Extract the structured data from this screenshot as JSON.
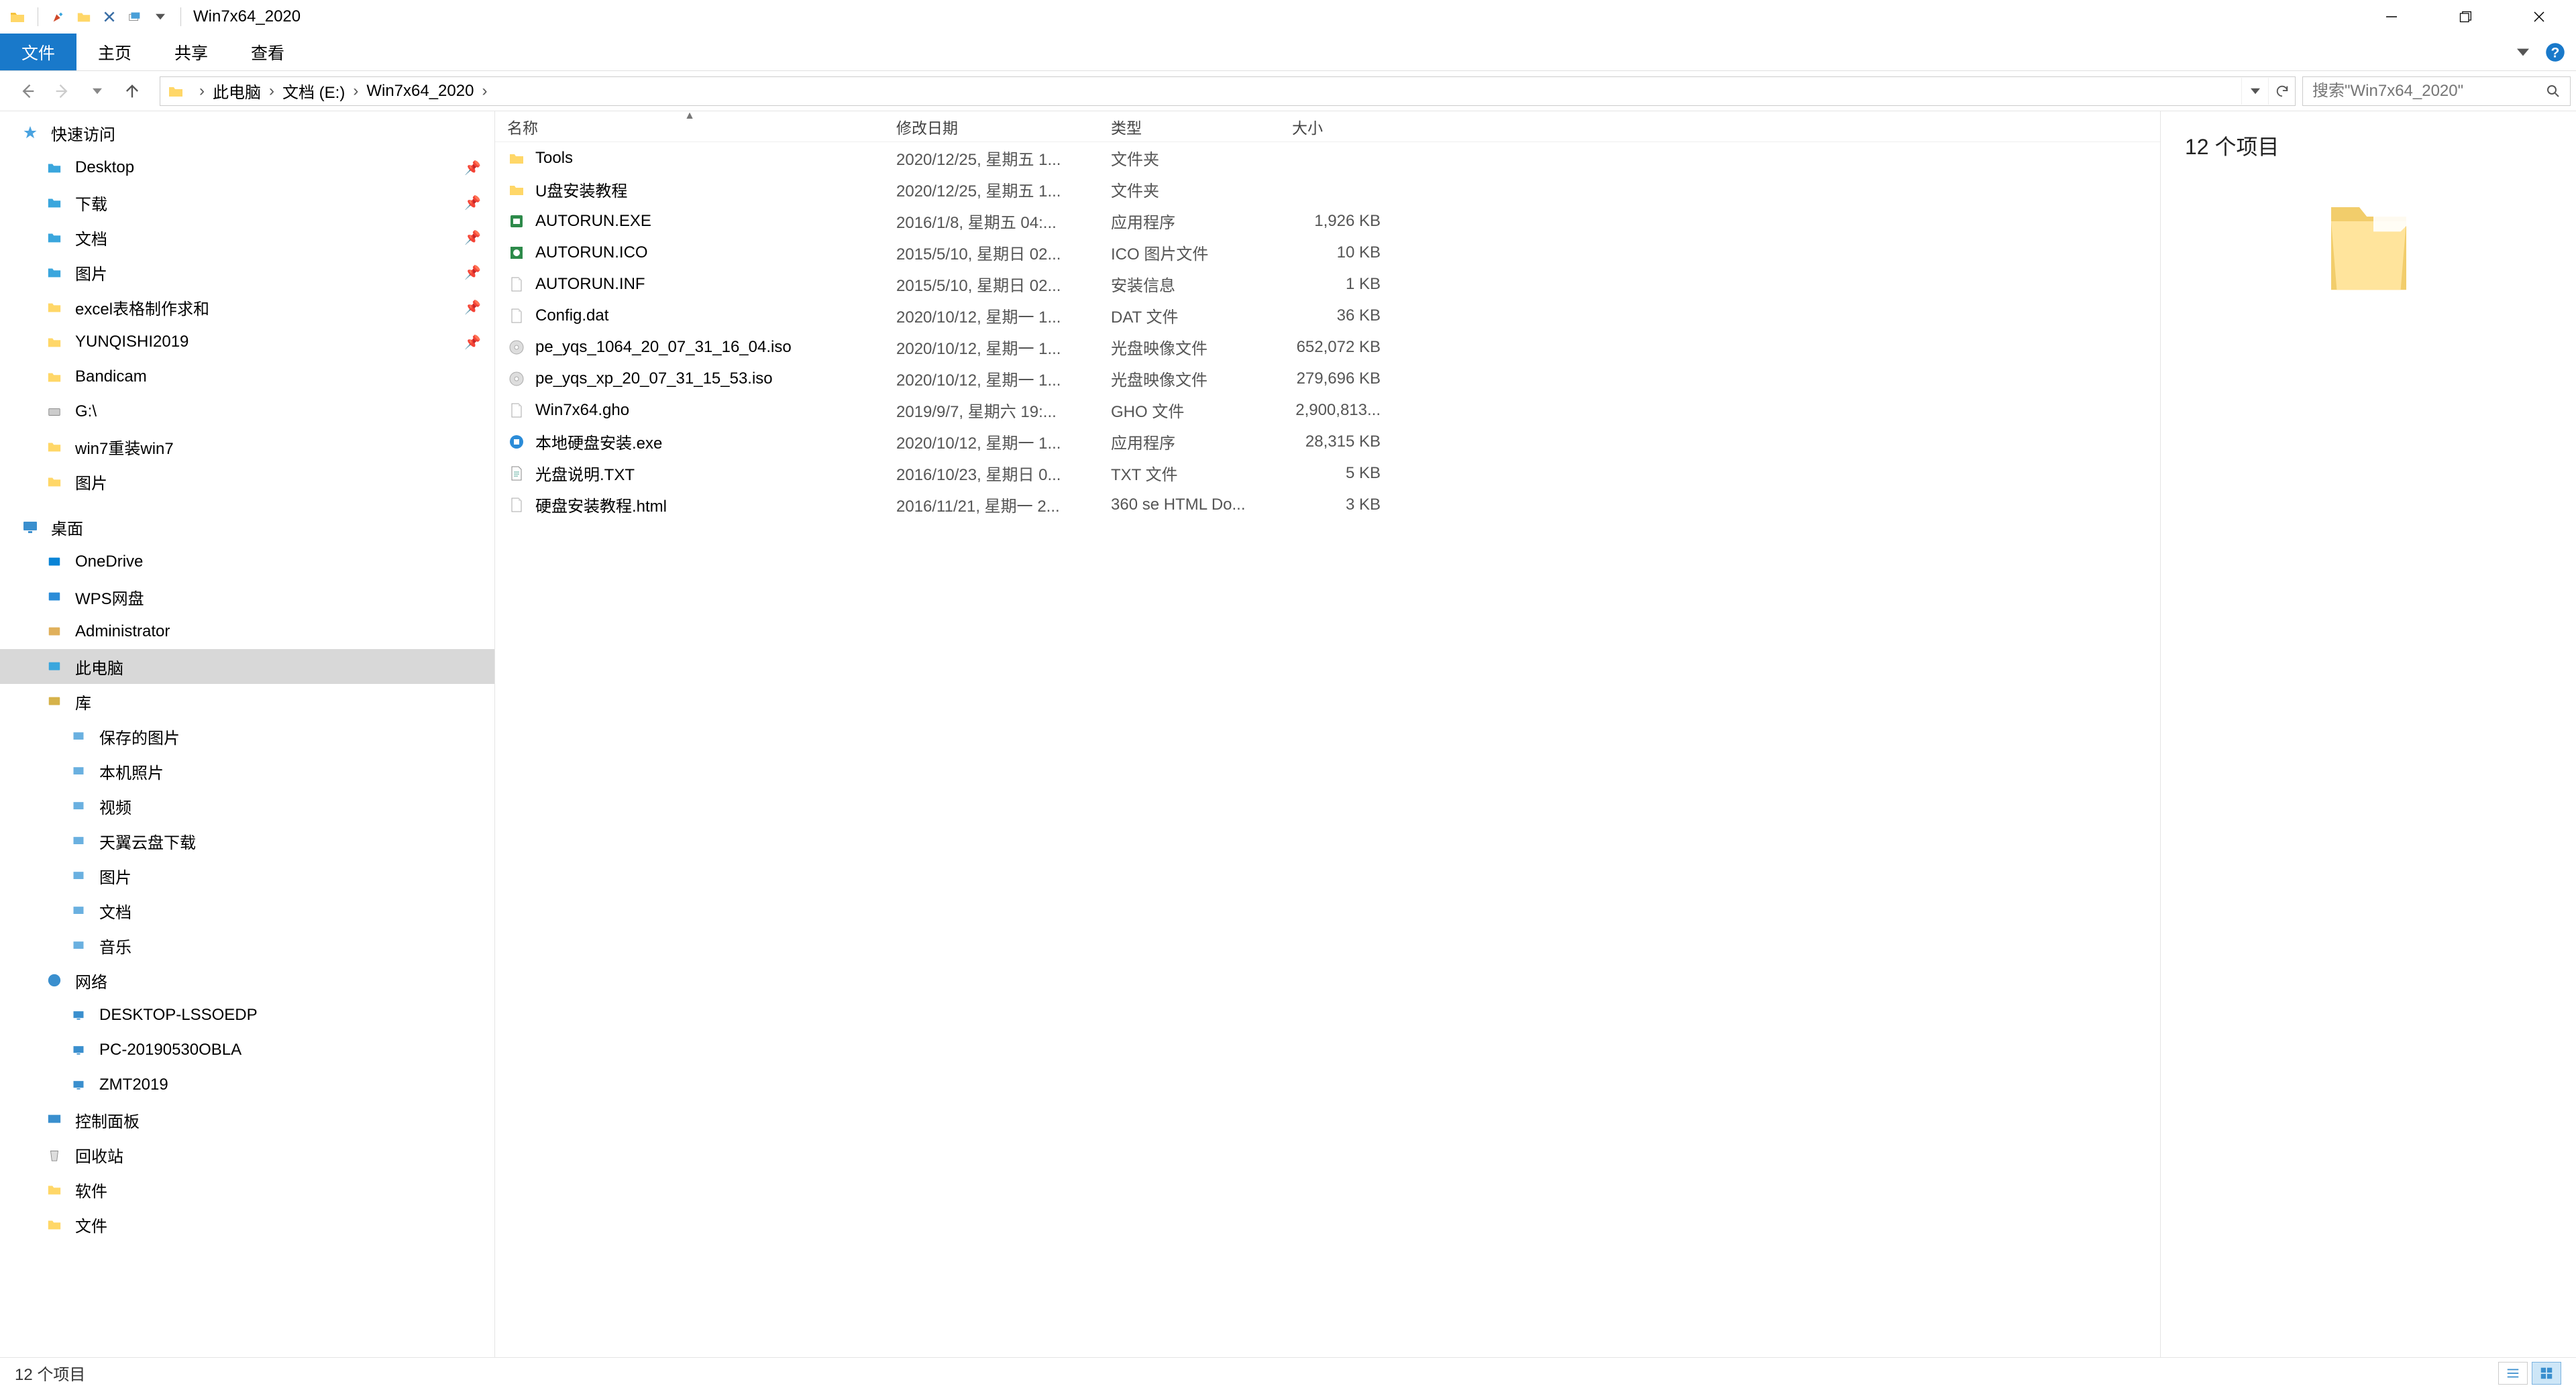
{
  "window": {
    "title": "Win7x64_2020"
  },
  "ribbon": {
    "file": "文件",
    "tabs": [
      "主页",
      "共享",
      "查看"
    ]
  },
  "breadcrumb": [
    "此电脑",
    "文档 (E:)",
    "Win7x64_2020"
  ],
  "search": {
    "placeholder": "搜索\"Win7x64_2020\""
  },
  "sidebar": {
    "quick": "快速访问",
    "quick_items": [
      {
        "label": "Desktop",
        "pin": true,
        "color": "#3aa6dd"
      },
      {
        "label": "下载",
        "pin": true,
        "color": "#3aa6dd"
      },
      {
        "label": "文档",
        "pin": true,
        "color": "#3aa6dd"
      },
      {
        "label": "图片",
        "pin": true,
        "color": "#3aa6dd"
      },
      {
        "label": "excel表格制作求和",
        "pin": true,
        "color": "#ffd768"
      },
      {
        "label": "YUNQISHI2019",
        "pin": true,
        "color": "#ffd768"
      },
      {
        "label": "Bandicam",
        "pin": false,
        "color": "#ffd768"
      },
      {
        "label": "G:\\",
        "pin": false,
        "color": "#9aa0a6"
      },
      {
        "label": "win7重装win7",
        "pin": false,
        "color": "#ffd768"
      },
      {
        "label": "图片",
        "pin": false,
        "color": "#ffd768"
      }
    ],
    "desktop": "桌面",
    "desktop_items": [
      {
        "label": "OneDrive",
        "color": "#0a84d6"
      },
      {
        "label": "WPS网盘",
        "color": "#2b8cd8"
      },
      {
        "label": "Administrator",
        "color": "#e0b05b"
      },
      {
        "label": "此电脑",
        "color": "#3aa6dd",
        "sel": true
      },
      {
        "label": "库",
        "color": "#d6b24a"
      }
    ],
    "lib_items": [
      {
        "label": "保存的图片"
      },
      {
        "label": "本机照片"
      },
      {
        "label": "视频"
      },
      {
        "label": "天翼云盘下载"
      },
      {
        "label": "图片"
      },
      {
        "label": "文档"
      },
      {
        "label": "音乐"
      }
    ],
    "net": "网络",
    "net_items": [
      {
        "label": "DESKTOP-LSSOEDP"
      },
      {
        "label": "PC-20190530OBLA"
      },
      {
        "label": "ZMT2019"
      }
    ],
    "ctrl": "控制面板",
    "recycle": "回收站",
    "soft": "软件",
    "wenjian": "文件"
  },
  "columns": {
    "name": "名称",
    "date": "修改日期",
    "type": "类型",
    "size": "大小"
  },
  "files": [
    {
      "icon": "folder",
      "name": "Tools",
      "date": "2020/12/25, 星期五 1...",
      "type": "文件夹",
      "size": ""
    },
    {
      "icon": "folder",
      "name": "U盘安装教程",
      "date": "2020/12/25, 星期五 1...",
      "type": "文件夹",
      "size": ""
    },
    {
      "icon": "exe",
      "name": "AUTORUN.EXE",
      "date": "2016/1/8, 星期五 04:...",
      "type": "应用程序",
      "size": "1,926 KB"
    },
    {
      "icon": "ico",
      "name": "AUTORUN.ICO",
      "date": "2015/5/10, 星期日 02...",
      "type": "ICO 图片文件",
      "size": "10 KB"
    },
    {
      "icon": "inf",
      "name": "AUTORUN.INF",
      "date": "2015/5/10, 星期日 02...",
      "type": "安装信息",
      "size": "1 KB"
    },
    {
      "icon": "dat",
      "name": "Config.dat",
      "date": "2020/10/12, 星期一 1...",
      "type": "DAT 文件",
      "size": "36 KB"
    },
    {
      "icon": "iso",
      "name": "pe_yqs_1064_20_07_31_16_04.iso",
      "date": "2020/10/12, 星期一 1...",
      "type": "光盘映像文件",
      "size": "652,072 KB"
    },
    {
      "icon": "iso",
      "name": "pe_yqs_xp_20_07_31_15_53.iso",
      "date": "2020/10/12, 星期一 1...",
      "type": "光盘映像文件",
      "size": "279,696 KB"
    },
    {
      "icon": "gho",
      "name": "Win7x64.gho",
      "date": "2019/9/7, 星期六 19:...",
      "type": "GHO 文件",
      "size": "2,900,813..."
    },
    {
      "icon": "exe2",
      "name": "本地硬盘安装.exe",
      "date": "2020/10/12, 星期一 1...",
      "type": "应用程序",
      "size": "28,315 KB"
    },
    {
      "icon": "txt",
      "name": "光盘说明.TXT",
      "date": "2016/10/23, 星期日 0...",
      "type": "TXT 文件",
      "size": "5 KB"
    },
    {
      "icon": "html",
      "name": "硬盘安装教程.html",
      "date": "2016/11/21, 星期一 2...",
      "type": "360 se HTML Do...",
      "size": "3 KB"
    }
  ],
  "preview": {
    "header": "12 个项目"
  },
  "status": {
    "text": "12 个项目"
  }
}
